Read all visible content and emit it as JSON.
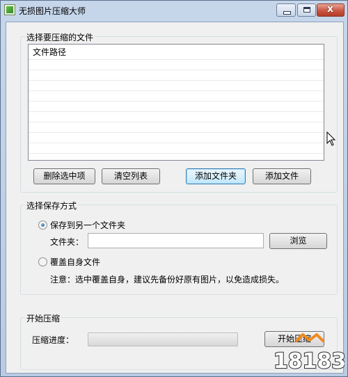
{
  "window": {
    "title": "无损图片压缩大师",
    "min_icon": "minimize-icon",
    "max_icon": "maximize-icon",
    "close_icon": "close-icon",
    "close_glyph": "x"
  },
  "select_files": {
    "group_title": "选择要压缩的文件",
    "column_header": "文件路径",
    "rows": [],
    "buttons": {
      "remove_selected": "删除选中项",
      "clear_list": "清空列表",
      "add_folder": "添加文件夹",
      "add_file": "添加文件"
    }
  },
  "save_mode": {
    "group_title": "选择保存方式",
    "option_other_folder": "保存到另一个文件夹",
    "option_other_folder_checked": true,
    "folder_label": "文件夹：",
    "folder_value": "",
    "browse": "浏览",
    "option_overwrite": "覆盖自身文件",
    "option_overwrite_checked": false,
    "note": "注意：选中覆盖自身，建议先备份好原有图片，以免造成损失。"
  },
  "start": {
    "group_title": "开始压缩",
    "progress_label": "压缩进度：",
    "progress_fraction": 0,
    "start_button": "开始压缩"
  },
  "watermark": {
    "text": "18183",
    "colors": {
      "orange": "#f08a1c",
      "dark": "#2a2a2a"
    }
  }
}
